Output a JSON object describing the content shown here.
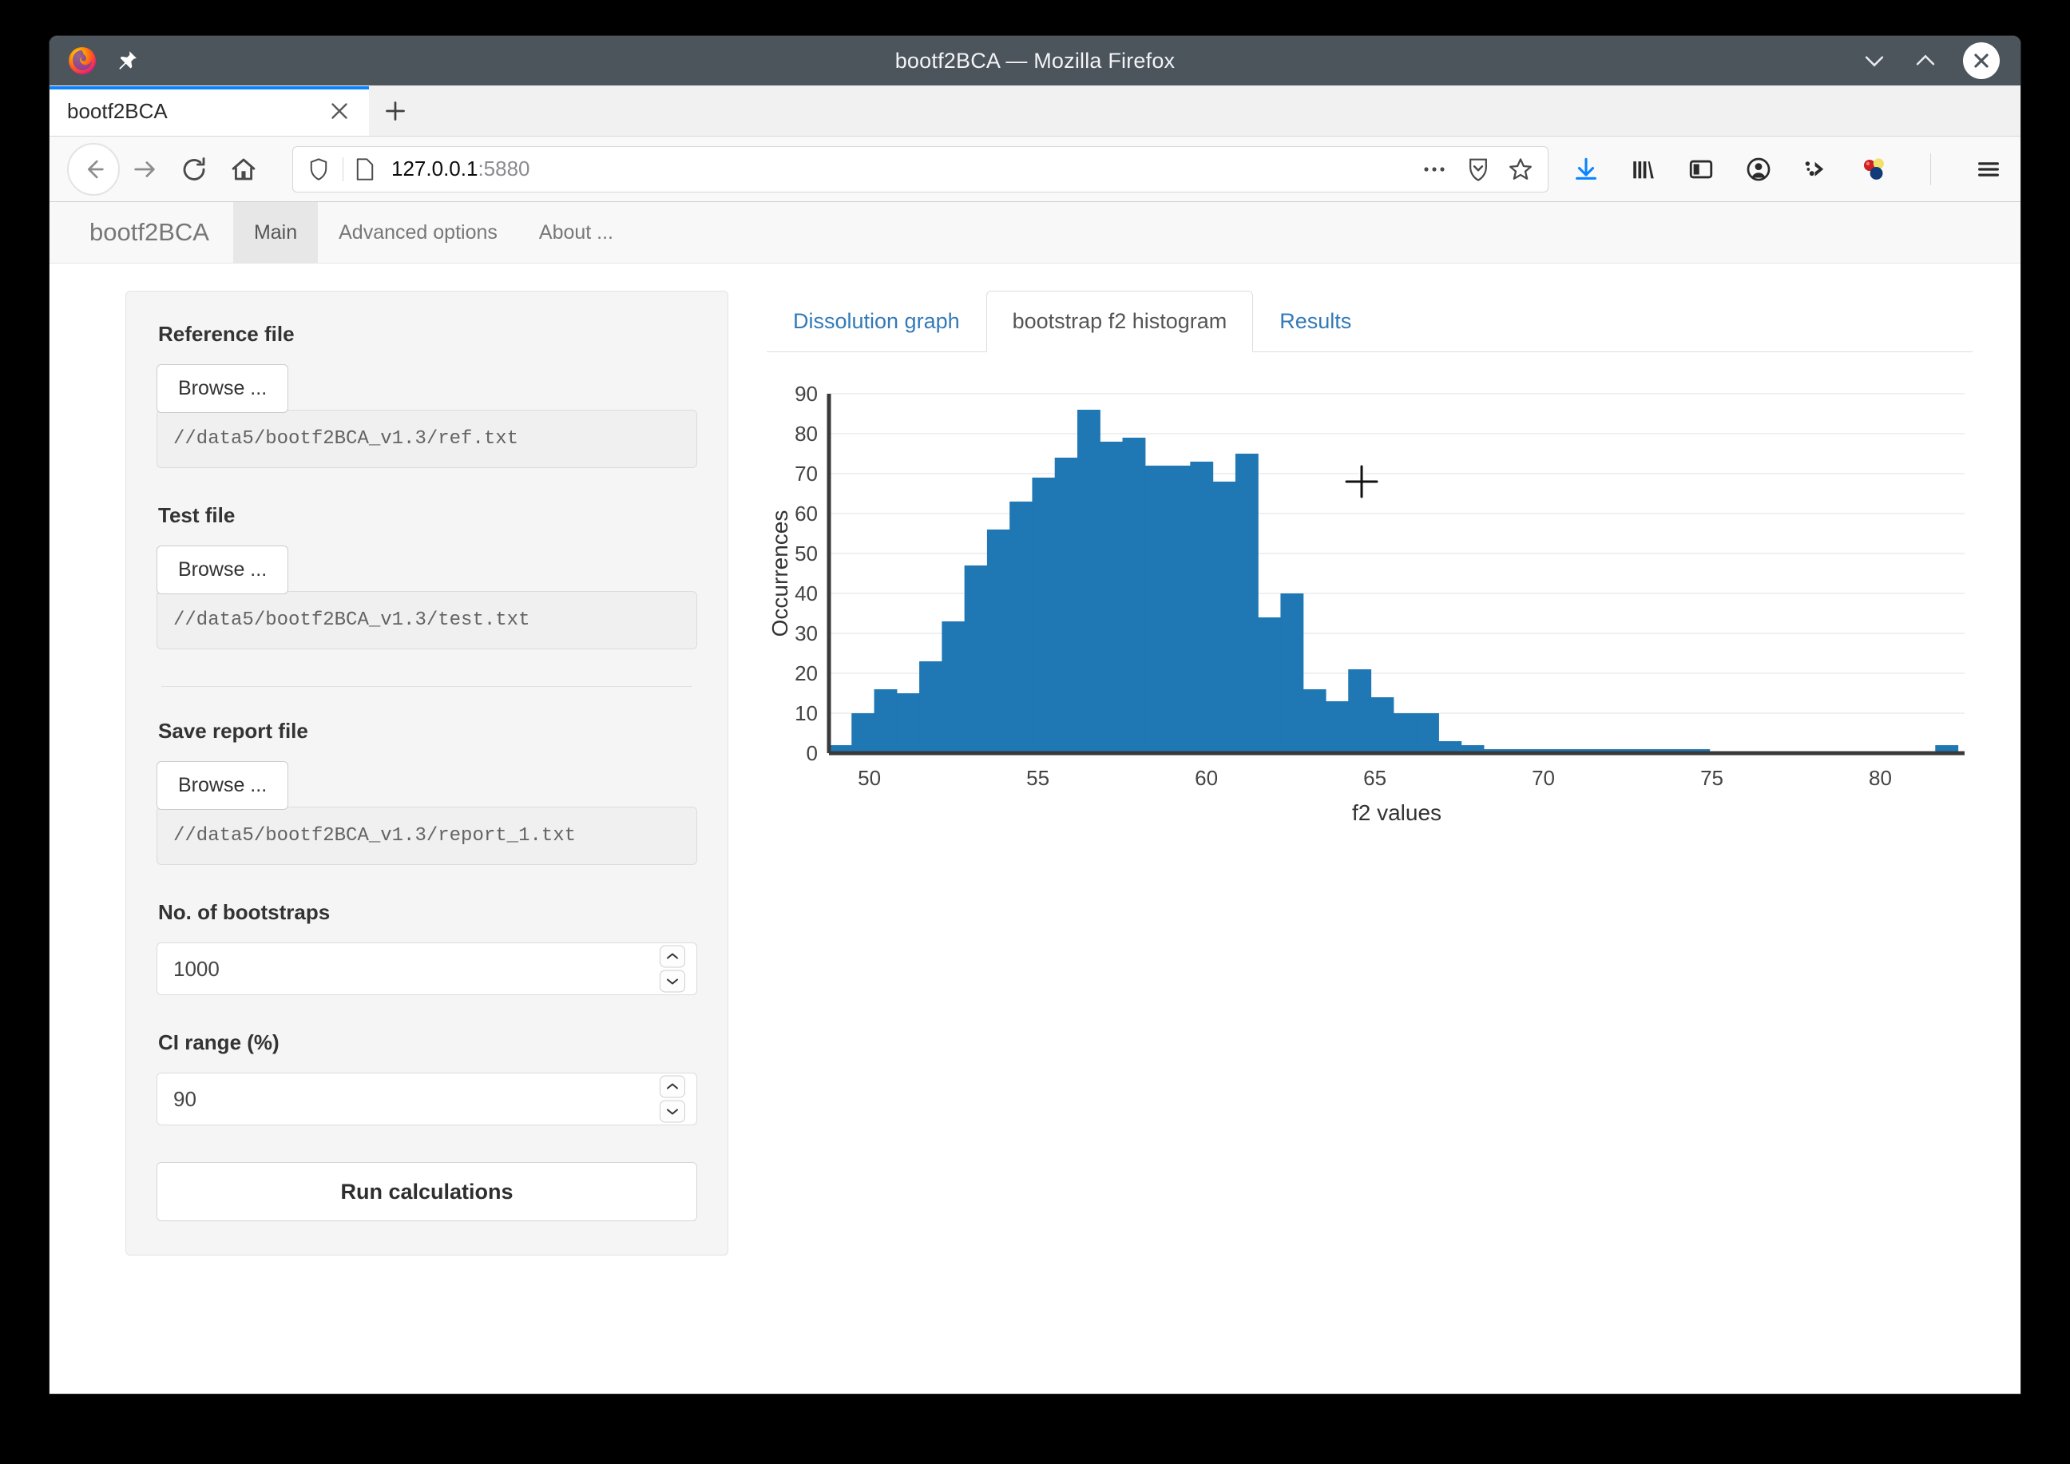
{
  "window": {
    "title": "bootf2BCA — Mozilla Firefox",
    "controls": {
      "minimize": "chevron-down-icon",
      "maximize": "chevron-up-icon",
      "close": "close-icon"
    }
  },
  "browser": {
    "tab": {
      "label": "bootf2BCA",
      "close": "×"
    },
    "newtab": "+",
    "url": {
      "host": "127.0.0.1",
      "port": ":5880"
    },
    "nav_icons": [
      "back-icon",
      "forward-icon",
      "reload-icon",
      "home-icon"
    ],
    "url_icons": [
      "shield-icon",
      "page-icon",
      "ellipsis-icon",
      "pocket-icon",
      "bookmark-star-icon"
    ],
    "toolbar_icons": [
      "downloads-icon",
      "library-icon",
      "sidebar-icon",
      "account-icon",
      "devtools-icon",
      "extension-icon",
      "menu-icon"
    ]
  },
  "app": {
    "brand": "bootf2BCA",
    "nav": [
      {
        "label": "Main",
        "active": true
      },
      {
        "label": "Advanced options",
        "active": false
      },
      {
        "label": "About ...",
        "active": false
      }
    ]
  },
  "sidebar": {
    "reference": {
      "label": "Reference file",
      "browse_label": "Browse ...",
      "path": "//data5/bootf2BCA_v1.3/ref.txt"
    },
    "test": {
      "label": "Test file",
      "browse_label": "Browse ...",
      "path": "//data5/bootf2BCA_v1.3/test.txt"
    },
    "report": {
      "label": "Save report file",
      "browse_label": "Browse ...",
      "path": "//data5/bootf2BCA_v1.3/report_1.txt"
    },
    "bootstraps": {
      "label": "No. of bootstraps",
      "value": "1000"
    },
    "ci_range": {
      "label": "CI range (%)",
      "value": "90"
    },
    "run_button": "Run calculations"
  },
  "main": {
    "tabs": [
      {
        "label": "Dissolution graph",
        "active": false
      },
      {
        "label": "bootstrap f2 histogram",
        "active": true
      },
      {
        "label": "Results",
        "active": false
      }
    ]
  },
  "colors": {
    "bar": "#1f77b4",
    "axis": "#3a3a3a",
    "grid": "#f0f0f0",
    "link": "#337ab7",
    "tab_accent": "#0a84ff",
    "titlebar": "#4c545c"
  },
  "chart_data": {
    "type": "bar",
    "title": "",
    "xlabel": "f2 values",
    "ylabel": "Occurrences",
    "xlim": [
      48.8,
      82.5
    ],
    "ylim": [
      0,
      90
    ],
    "xticks": [
      50,
      55,
      60,
      65,
      70,
      75,
      80
    ],
    "yticks": [
      0,
      10,
      20,
      30,
      40,
      50,
      60,
      70,
      80,
      90
    ],
    "grid": "horizontal",
    "legend": "none",
    "bin_width": 0.67,
    "bin_starts": [
      48.8,
      49.47,
      50.14,
      50.81,
      51.48,
      52.15,
      52.82,
      53.49,
      54.16,
      54.83,
      55.5,
      56.17,
      56.84,
      57.51,
      58.18,
      58.85,
      59.52,
      60.19,
      60.86,
      61.53,
      62.2,
      62.87,
      63.54,
      64.21,
      64.88,
      65.55,
      66.22,
      66.89,
      67.56,
      68.23,
      68.9,
      69.57,
      70.24,
      70.91,
      71.58,
      72.25,
      72.92,
      73.59,
      74.26,
      74.93,
      75.6,
      76.27,
      76.94,
      77.61,
      78.28,
      78.95,
      79.62,
      80.29,
      80.96,
      81.63
    ],
    "values": [
      2,
      10,
      16,
      15,
      23,
      33,
      47,
      56,
      63,
      69,
      74,
      86,
      78,
      79,
      72,
      72,
      73,
      68,
      75,
      34,
      40,
      16,
      13,
      21,
      14,
      10,
      10,
      3,
      2,
      1,
      1,
      1,
      1,
      1,
      1,
      1,
      1,
      1,
      1,
      0,
      0,
      0,
      0,
      0,
      0,
      0,
      0,
      0,
      0,
      2
    ],
    "cursor": {
      "icon": "crosshair-cursor",
      "x_f2": 64.6,
      "y_occurrences": 68
    }
  }
}
